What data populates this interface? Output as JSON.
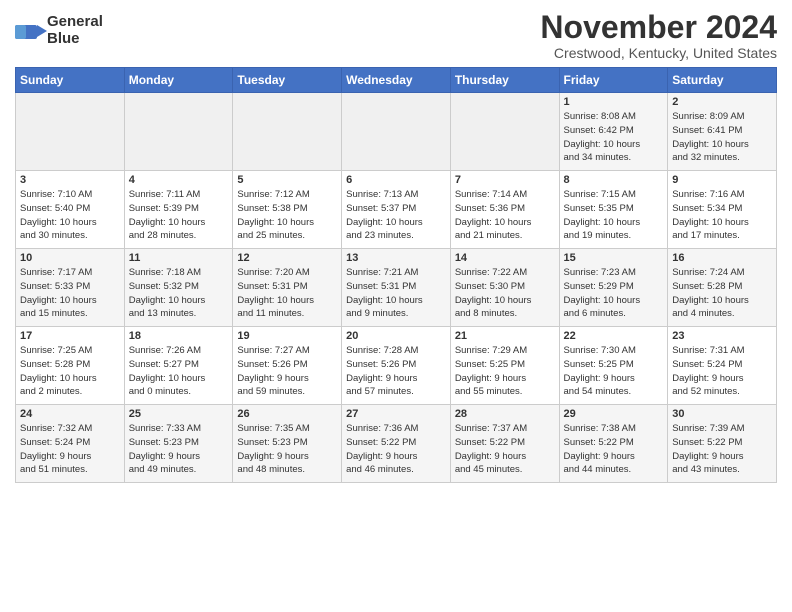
{
  "header": {
    "logo_line1": "General",
    "logo_line2": "Blue",
    "month": "November 2024",
    "location": "Crestwood, Kentucky, United States"
  },
  "days_of_week": [
    "Sunday",
    "Monday",
    "Tuesday",
    "Wednesday",
    "Thursday",
    "Friday",
    "Saturday"
  ],
  "weeks": [
    [
      {
        "num": "",
        "info": ""
      },
      {
        "num": "",
        "info": ""
      },
      {
        "num": "",
        "info": ""
      },
      {
        "num": "",
        "info": ""
      },
      {
        "num": "",
        "info": ""
      },
      {
        "num": "1",
        "info": "Sunrise: 8:08 AM\nSunset: 6:42 PM\nDaylight: 10 hours\nand 34 minutes."
      },
      {
        "num": "2",
        "info": "Sunrise: 8:09 AM\nSunset: 6:41 PM\nDaylight: 10 hours\nand 32 minutes."
      }
    ],
    [
      {
        "num": "3",
        "info": "Sunrise: 7:10 AM\nSunset: 5:40 PM\nDaylight: 10 hours\nand 30 minutes."
      },
      {
        "num": "4",
        "info": "Sunrise: 7:11 AM\nSunset: 5:39 PM\nDaylight: 10 hours\nand 28 minutes."
      },
      {
        "num": "5",
        "info": "Sunrise: 7:12 AM\nSunset: 5:38 PM\nDaylight: 10 hours\nand 25 minutes."
      },
      {
        "num": "6",
        "info": "Sunrise: 7:13 AM\nSunset: 5:37 PM\nDaylight: 10 hours\nand 23 minutes."
      },
      {
        "num": "7",
        "info": "Sunrise: 7:14 AM\nSunset: 5:36 PM\nDaylight: 10 hours\nand 21 minutes."
      },
      {
        "num": "8",
        "info": "Sunrise: 7:15 AM\nSunset: 5:35 PM\nDaylight: 10 hours\nand 19 minutes."
      },
      {
        "num": "9",
        "info": "Sunrise: 7:16 AM\nSunset: 5:34 PM\nDaylight: 10 hours\nand 17 minutes."
      }
    ],
    [
      {
        "num": "10",
        "info": "Sunrise: 7:17 AM\nSunset: 5:33 PM\nDaylight: 10 hours\nand 15 minutes."
      },
      {
        "num": "11",
        "info": "Sunrise: 7:18 AM\nSunset: 5:32 PM\nDaylight: 10 hours\nand 13 minutes."
      },
      {
        "num": "12",
        "info": "Sunrise: 7:20 AM\nSunset: 5:31 PM\nDaylight: 10 hours\nand 11 minutes."
      },
      {
        "num": "13",
        "info": "Sunrise: 7:21 AM\nSunset: 5:31 PM\nDaylight: 10 hours\nand 9 minutes."
      },
      {
        "num": "14",
        "info": "Sunrise: 7:22 AM\nSunset: 5:30 PM\nDaylight: 10 hours\nand 8 minutes."
      },
      {
        "num": "15",
        "info": "Sunrise: 7:23 AM\nSunset: 5:29 PM\nDaylight: 10 hours\nand 6 minutes."
      },
      {
        "num": "16",
        "info": "Sunrise: 7:24 AM\nSunset: 5:28 PM\nDaylight: 10 hours\nand 4 minutes."
      }
    ],
    [
      {
        "num": "17",
        "info": "Sunrise: 7:25 AM\nSunset: 5:28 PM\nDaylight: 10 hours\nand 2 minutes."
      },
      {
        "num": "18",
        "info": "Sunrise: 7:26 AM\nSunset: 5:27 PM\nDaylight: 10 hours\nand 0 minutes."
      },
      {
        "num": "19",
        "info": "Sunrise: 7:27 AM\nSunset: 5:26 PM\nDaylight: 9 hours\nand 59 minutes."
      },
      {
        "num": "20",
        "info": "Sunrise: 7:28 AM\nSunset: 5:26 PM\nDaylight: 9 hours\nand 57 minutes."
      },
      {
        "num": "21",
        "info": "Sunrise: 7:29 AM\nSunset: 5:25 PM\nDaylight: 9 hours\nand 55 minutes."
      },
      {
        "num": "22",
        "info": "Sunrise: 7:30 AM\nSunset: 5:25 PM\nDaylight: 9 hours\nand 54 minutes."
      },
      {
        "num": "23",
        "info": "Sunrise: 7:31 AM\nSunset: 5:24 PM\nDaylight: 9 hours\nand 52 minutes."
      }
    ],
    [
      {
        "num": "24",
        "info": "Sunrise: 7:32 AM\nSunset: 5:24 PM\nDaylight: 9 hours\nand 51 minutes."
      },
      {
        "num": "25",
        "info": "Sunrise: 7:33 AM\nSunset: 5:23 PM\nDaylight: 9 hours\nand 49 minutes."
      },
      {
        "num": "26",
        "info": "Sunrise: 7:35 AM\nSunset: 5:23 PM\nDaylight: 9 hours\nand 48 minutes."
      },
      {
        "num": "27",
        "info": "Sunrise: 7:36 AM\nSunset: 5:22 PM\nDaylight: 9 hours\nand 46 minutes."
      },
      {
        "num": "28",
        "info": "Sunrise: 7:37 AM\nSunset: 5:22 PM\nDaylight: 9 hours\nand 45 minutes."
      },
      {
        "num": "29",
        "info": "Sunrise: 7:38 AM\nSunset: 5:22 PM\nDaylight: 9 hours\nand 44 minutes."
      },
      {
        "num": "30",
        "info": "Sunrise: 7:39 AM\nSunset: 5:22 PM\nDaylight: 9 hours\nand 43 minutes."
      }
    ]
  ]
}
